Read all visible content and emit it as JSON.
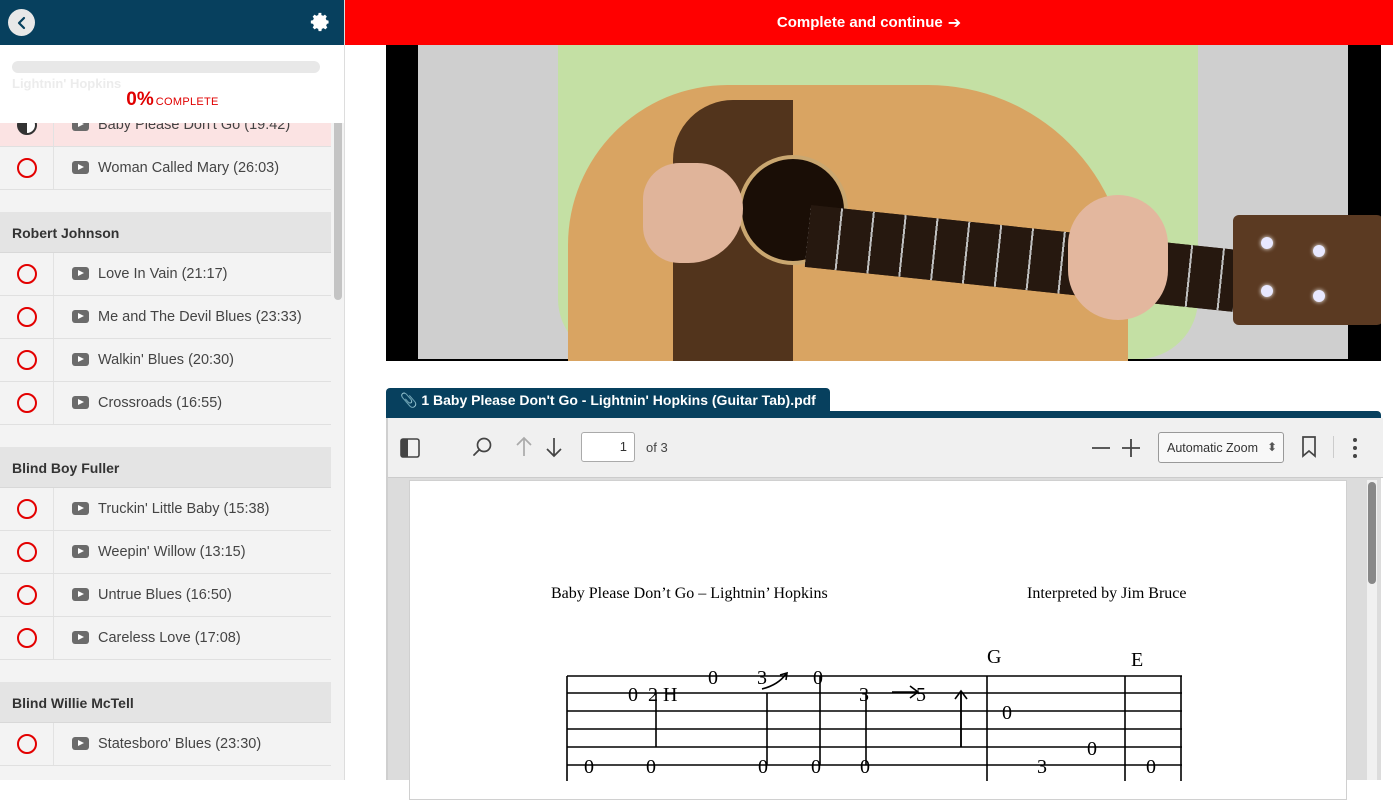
{
  "topbar": {
    "complete_label": "Complete and continue",
    "arrow": "➔"
  },
  "sidebar": {
    "ghost_section": "Lightnin' Hopkins",
    "progress": {
      "percent_label": "0%",
      "word": "COMPLETE",
      "value": 0
    },
    "active_lesson": {
      "title": "Baby Please Don't Go (19:42)"
    },
    "lessons_top": [
      {
        "title": "Woman Called Mary (26:03)"
      }
    ],
    "sections": [
      {
        "title": "Robert Johnson",
        "lessons": [
          {
            "title": "Love In Vain (21:17)"
          },
          {
            "title": "Me and The Devil Blues (23:33)"
          },
          {
            "title": "Walkin' Blues (20:30)"
          },
          {
            "title": "Crossroads (16:55)"
          }
        ]
      },
      {
        "title": "Blind Boy Fuller",
        "lessons": [
          {
            "title": "Truckin' Little Baby (15:38)"
          },
          {
            "title": "Weepin' Willow (13:15)"
          },
          {
            "title": "Untrue Blues (16:50)"
          },
          {
            "title": "Careless Love (17:08)"
          }
        ]
      },
      {
        "title": "Blind Willie McTell",
        "lessons": [
          {
            "title": "Statesboro' Blues (23:30)"
          }
        ]
      }
    ]
  },
  "attachment": {
    "label": "📎 1 Baby Please Don't Go - Lightnin' Hopkins (Guitar Tab).pdf"
  },
  "pdf_viewer": {
    "page_number": "1",
    "page_count_label": "of 3",
    "zoom": "Automatic Zoom",
    "doc_title": "Baby Please Don’t Go – Lightnin’ Hopkins",
    "doc_credit": "Interpreted by Jim Bruce",
    "chords": [
      "G",
      "E"
    ],
    "tab_numbers": [
      "0",
      "3",
      "0",
      "0",
      "2",
      "H",
      "3",
      "5",
      "0",
      "0",
      "0",
      "0",
      "0",
      "0",
      "0",
      "3",
      "0"
    ]
  },
  "colors": {
    "header_navy": "#07405e",
    "accent_red": "#ff0000",
    "status_red": "#e30000"
  }
}
